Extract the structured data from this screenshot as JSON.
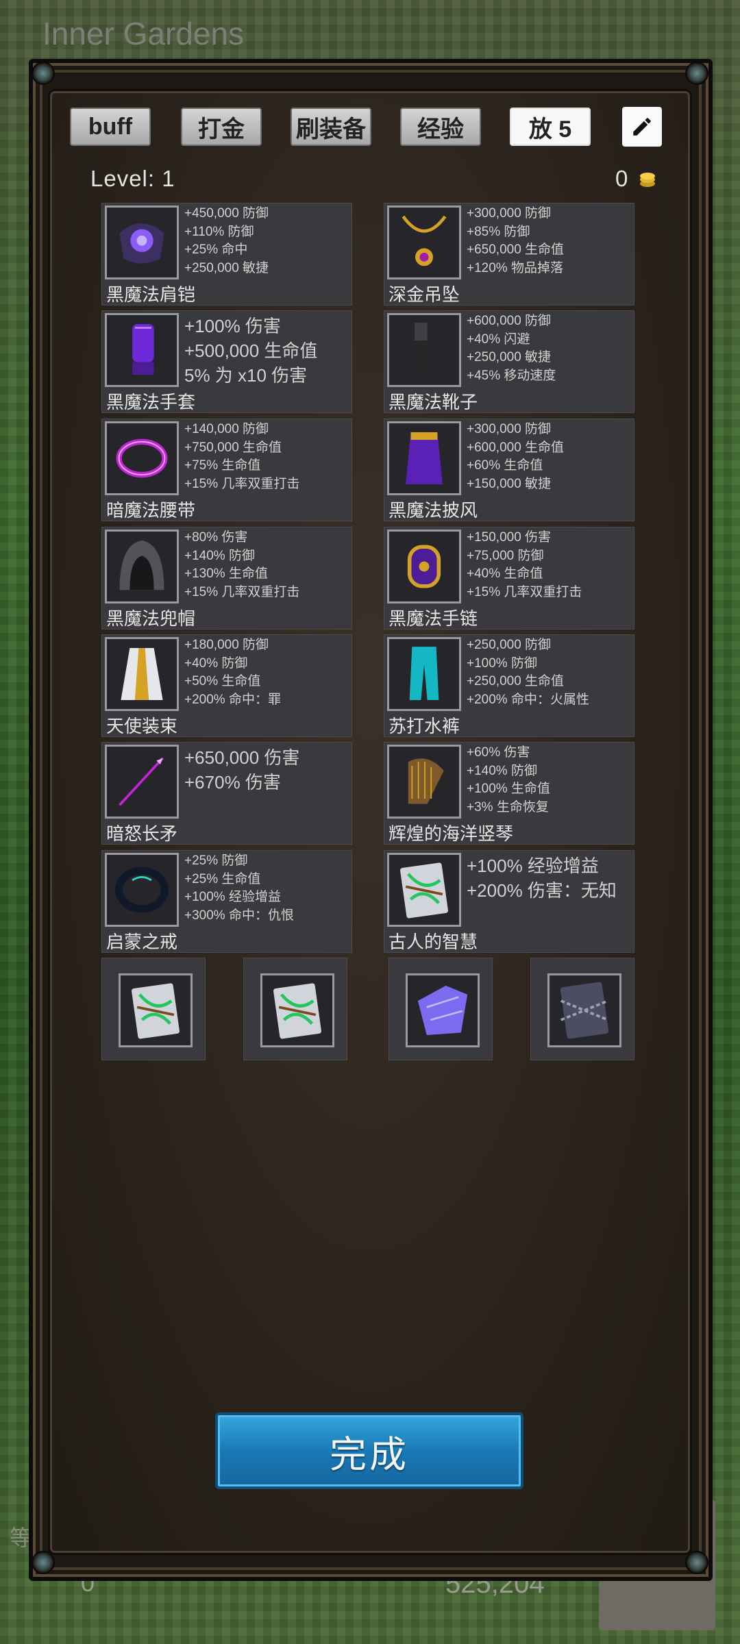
{
  "background": {
    "title": "Inner Gardens",
    "bottom_left_value": "0",
    "bottom_right_value": "525,204",
    "side_char": "等"
  },
  "tabs": [
    {
      "label": "buff"
    },
    {
      "label": "打金"
    },
    {
      "label": "刷装备"
    },
    {
      "label": "经验"
    },
    {
      "label": "放 5"
    }
  ],
  "edit_icon": "pencil-icon",
  "level_label": "Level: 1",
  "coins": "0",
  "coin_icon": "gold-coins-icon",
  "items": [
    {
      "name": "黑魔法肩铠",
      "icon": "shoulder-armor-icon",
      "stats": [
        "+450,000 防御",
        "+110% 防御",
        "+25% 命中",
        "+250,000 敏捷"
      ]
    },
    {
      "name": "深金吊坠",
      "icon": "pendant-icon",
      "stats": [
        "+300,000 防御",
        "+85% 防御",
        "+650,000 生命值",
        "+120% 物品掉落"
      ]
    },
    {
      "name": "黑魔法手套",
      "icon": "gloves-icon",
      "big": true,
      "stats": [
        "+100% 伤害",
        "+500,000 生命值",
        "5% 为 x10 伤害"
      ]
    },
    {
      "name": "黑魔法靴子",
      "icon": "boots-icon",
      "stats": [
        "+600,000 防御",
        "+40% 闪避",
        "+250,000 敏捷",
        "+45% 移动速度"
      ]
    },
    {
      "name": "暗魔法腰带",
      "icon": "belt-icon",
      "stats": [
        "+140,000 防御",
        "+750,000 生命值",
        "+75% 生命值",
        "+15% 几率双重打击"
      ]
    },
    {
      "name": "黑魔法披风",
      "icon": "cape-icon",
      "stats": [
        "+300,000 防御",
        "+600,000 生命值",
        "+60% 生命值",
        "+150,000 敏捷"
      ]
    },
    {
      "name": "黑魔法兜帽",
      "icon": "hood-icon",
      "stats": [
        "+80% 伤害",
        "+140% 防御",
        "+130% 生命值",
        "+15% 几率双重打击"
      ]
    },
    {
      "name": "黑魔法手链",
      "icon": "bracelet-icon",
      "stats": [
        "+150,000 伤害",
        "+75,000 防御",
        "+40% 生命值",
        "+15% 几率双重打击"
      ]
    },
    {
      "name": "天使装束",
      "icon": "robe-icon",
      "stats": [
        "+180,000 防御",
        "+40% 防御",
        "+50% 生命值",
        "+200% 命中：罪"
      ]
    },
    {
      "name": "苏打水裤",
      "icon": "pants-icon",
      "stats": [
        "+250,000 防御",
        "+100% 防御",
        "+250,000 生命值",
        "+200% 命中：火属性"
      ]
    },
    {
      "name": "暗怒长矛",
      "icon": "spear-icon",
      "big": true,
      "stats": [
        "+650,000 伤害",
        "+670% 伤害"
      ]
    },
    {
      "name": "辉煌的海洋竖琴",
      "icon": "harp-icon",
      "stats": [
        "+60% 伤害",
        "+140% 防御",
        "+100% 生命值",
        "+3% 生命恢复"
      ]
    },
    {
      "name": "启蒙之戒",
      "icon": "ring-icon",
      "stats": [
        "+25% 防御",
        "+25% 生命值",
        "+100% 经验增益",
        "+300% 命中：仇恨"
      ]
    },
    {
      "name": "古人的智慧",
      "icon": "tome-icon",
      "big": true,
      "stats": [
        "+100% 经验增益",
        "+200% 伤害：无知"
      ]
    }
  ],
  "inventory": [
    {
      "icon": "tome-icon"
    },
    {
      "icon": "tome-icon"
    },
    {
      "icon": "purple-crystal-icon"
    },
    {
      "icon": "chained-tome-icon"
    }
  ],
  "done_label": "完成"
}
